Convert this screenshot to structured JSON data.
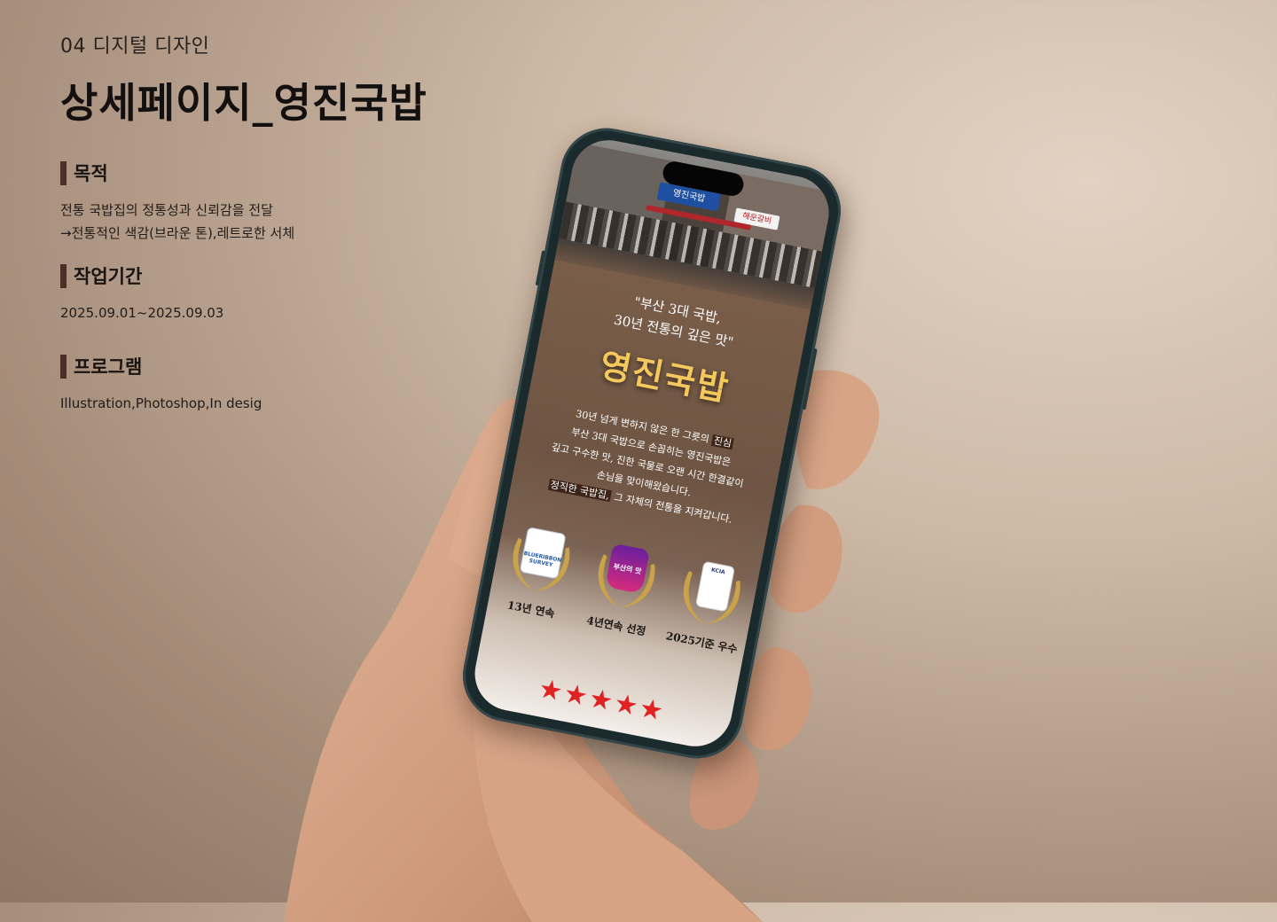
{
  "header": {
    "subtitle": "04 디지털 디자인",
    "title": "상세페이지_영진국밥"
  },
  "sections": {
    "purpose": {
      "heading": "목적",
      "lines": [
        "전통 국밥집의 정통성과 신뢰감을 전달",
        "→전통적인 색감(브라운 톤),레트로한 서체"
      ]
    },
    "period": {
      "heading": "작업기간",
      "value": "2025.09.01~2025.09.03"
    },
    "program": {
      "heading": "프로그램",
      "value": "Illustration,Photoshop,In desig"
    }
  },
  "phone_screen": {
    "quote_line1": "\"부산 3대 국밥,",
    "quote_line2": "30년 전통의 깊은 맛\"",
    "brand": "영진국밥",
    "story": {
      "line1_a": "30년 넘게 변하지 않은 한 그릇의 ",
      "line1_hl": "진심",
      "line2": "부산 3대 국밥으로 손꼽히는 영진국밥은",
      "line3": "깊고 구수한 맛, 진한 국물로 오랜 시간 한결같이",
      "line4": "손님을 맞이해왔습니다.",
      "line5_hl": "정직한 국밥집,",
      "line5_b": " 그 자체의 전통을 지켜갑니다."
    },
    "awards": [
      {
        "label": "13년 연속",
        "badge": "BLUERIBBON SURVEY"
      },
      {
        "label": "4년연속 선정",
        "badge": "부산의 맛"
      },
      {
        "label": "2025기준 우수",
        "badge": "KCIA"
      }
    ],
    "stars": "★★★★★",
    "photo_signs": {
      "left": "영진국밥",
      "right": "해운갈비"
    }
  },
  "colors": {
    "background": "#cdb9a6",
    "section_bar": "#4c2f25",
    "brand_gold": "#f4c85c",
    "star_red": "#e02222",
    "phone_frame": "#1b2a2c"
  }
}
